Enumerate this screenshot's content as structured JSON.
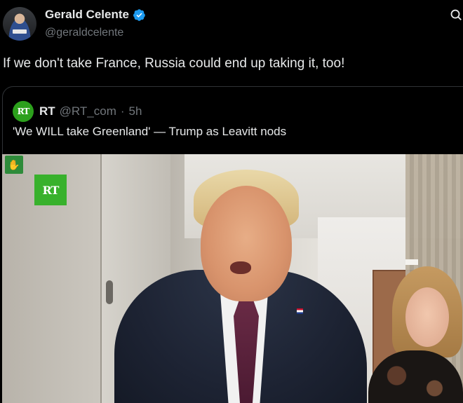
{
  "tweet": {
    "display_name": "Gerald Celente",
    "handle": "@geraldcelente",
    "verified_icon": "verified-badge-icon",
    "text": "If we don't take France, Russia could end up taking it, too!"
  },
  "quoted_tweet": {
    "avatar_text": "RT",
    "display_name": "RT",
    "handle": "@RT_com",
    "separator": "·",
    "time": "5h",
    "text": "'We WILL take Greenland' — Trump as Leavitt nods",
    "media": {
      "watermark": "RT"
    }
  },
  "colors": {
    "background": "#000000",
    "text_primary": "#e7e9ea",
    "text_secondary": "#71767b",
    "verified_blue": "#1d9bf0",
    "rt_green": "#38b12c",
    "border": "#2f3336"
  }
}
